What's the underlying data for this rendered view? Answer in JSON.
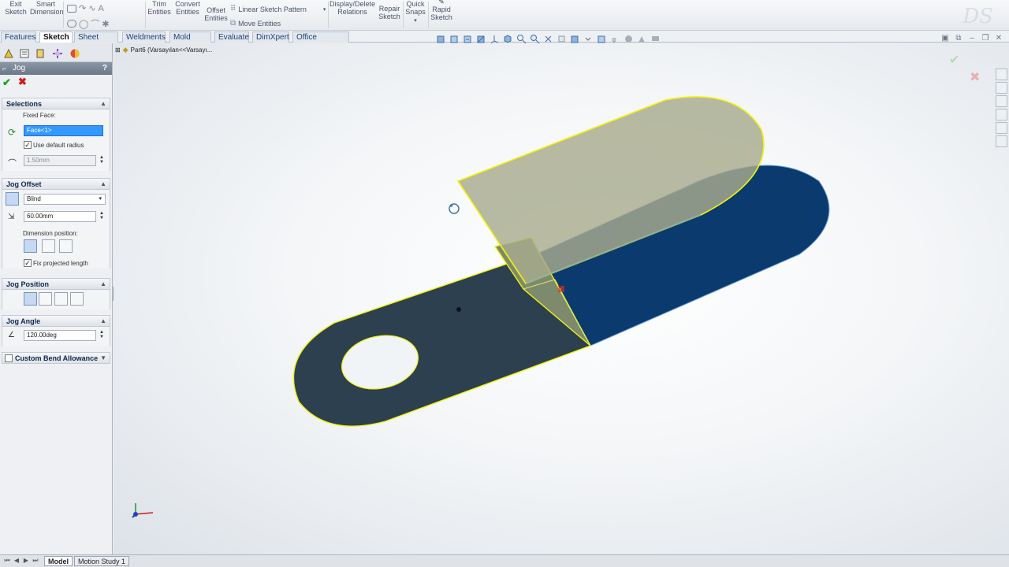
{
  "ribbon": {
    "exit_sketch": [
      "Exit",
      "Sketch"
    ],
    "smart_dimension": [
      "Smart",
      "Dimension"
    ],
    "trim_entities": [
      "Trim",
      "Entities"
    ],
    "convert_entities": [
      "Convert",
      "Entities"
    ],
    "offset_entities": [
      "Offset",
      "Entities"
    ],
    "linear_sketch_pattern": "Linear Sketch Pattern",
    "move_entities": "Move Entities",
    "display_delete_relations": [
      "Display/Delete",
      "Relations"
    ],
    "repair_sketch": [
      "Repair",
      "Sketch"
    ],
    "quick_snaps": [
      "Quick",
      "Snaps"
    ],
    "rapid_sketch": [
      "Rapid",
      "Sketch"
    ]
  },
  "tabs": [
    "Features",
    "Sketch",
    "Sheet Metal",
    "Weldments",
    "Mold Tools",
    "Evaluate",
    "DimXpert",
    "Office Products"
  ],
  "active_tab": "Sketch",
  "feature_tree": {
    "root": "Part6  (Varsayılan<<Varsayı..."
  },
  "property_manager": {
    "title": "Jog",
    "help": "?",
    "selections": {
      "header": "Selections",
      "fixed_face_label": "Fixed Face:",
      "fixed_face_value": "Face<1>",
      "use_default_radius_label": "Use default radius",
      "use_default_radius_checked": true,
      "radius_value": "1.50mm"
    },
    "jog_offset": {
      "header": "Jog Offset",
      "end_condition": "Blind",
      "distance": "60.00mm",
      "dimension_position_label": "Dimension position:",
      "fix_projected_length_label": "Fix projected length",
      "fix_projected_length_checked": true
    },
    "jog_position": {
      "header": "Jog Position"
    },
    "jog_angle": {
      "header": "Jog Angle",
      "value": "120.00deg"
    },
    "custom_bend_allowance": {
      "header": "Custom Bend Allowance",
      "checked": false
    }
  },
  "bottom_tabs": [
    "Model",
    "Motion Study 1"
  ],
  "active_bottom_tab": "Model",
  "colors": {
    "face_dark": "#2c4050",
    "face_selected": "#0b3a6e",
    "highlight_yellow": "#f2f20a",
    "accent_blue": "#1d3f7a"
  }
}
